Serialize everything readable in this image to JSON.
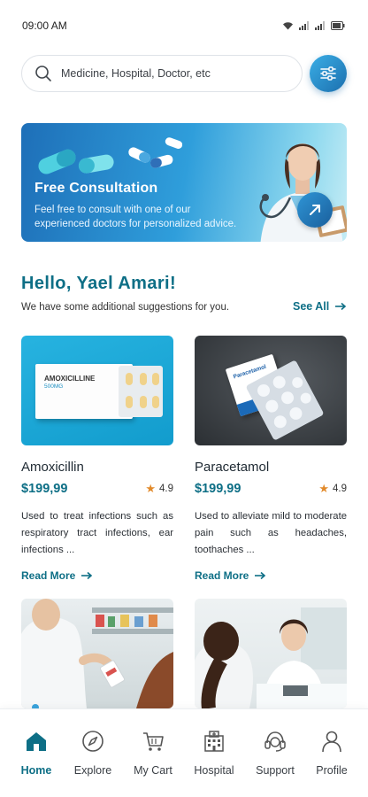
{
  "status_bar": {
    "time": "09:00 AM"
  },
  "search": {
    "placeholder": "Medicine, Hospital, Doctor, etc"
  },
  "banner": {
    "title": "Free Consultation",
    "text": "Feel free to consult with one of our experienced doctors for personalized advice."
  },
  "greeting": {
    "title": "Hello, Yael Amari!",
    "subtitle": "We have some additional suggestions for you.",
    "see_all": "See All"
  },
  "products": [
    {
      "name": "Amoxicillin",
      "price": "$199,99",
      "rating": "4.9",
      "description": "Used to treat infections such as respiratory tract infections, ear infections ...",
      "read_more": "Read More",
      "box_label": "AMOXICILLINE",
      "box_dose": "500MG"
    },
    {
      "name": "Paracetamol",
      "price": "$199,99",
      "rating": "4.9",
      "description": "Used to alleviate mild to moderate pain such as headaches, toothaches ...",
      "read_more": "Read More",
      "box_label": "Paracetamol"
    }
  ],
  "bottom_nav": {
    "items": [
      {
        "label": "Home",
        "icon": "home-icon",
        "active": true
      },
      {
        "label": "Explore",
        "icon": "compass-icon",
        "active": false
      },
      {
        "label": "My Cart",
        "icon": "cart-icon",
        "active": false
      },
      {
        "label": "Hospital",
        "icon": "hospital-icon",
        "active": false
      },
      {
        "label": "Support",
        "icon": "headset-icon",
        "active": false
      },
      {
        "label": "Profile",
        "icon": "user-icon",
        "active": false
      }
    ]
  },
  "colors": {
    "accent": "#0e6f86",
    "brand_blue": "#2f9edb",
    "star": "#e28a2a"
  }
}
